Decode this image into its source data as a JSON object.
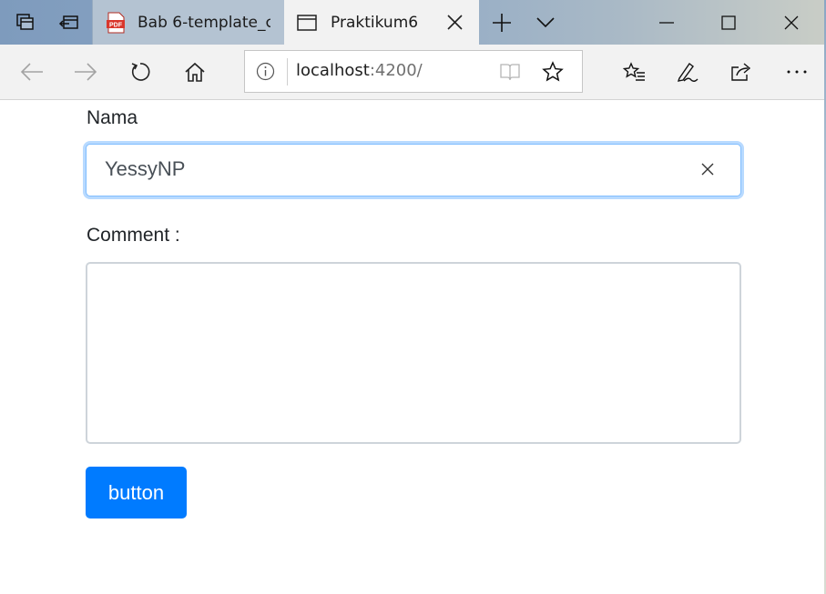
{
  "browser": {
    "tabs": [
      {
        "title": "Bab 6-template_c",
        "icon": "pdf-icon",
        "icon_label": "PDF",
        "active": false
      },
      {
        "title": "Praktikum6",
        "icon": "page-icon",
        "active": true
      }
    ],
    "address": {
      "host": "localhost",
      "rest": ":4200/"
    },
    "colors": {
      "tab_strip": "#8fa9c6",
      "toolbar": "#f2f2f2",
      "pdf_red": "#d9362b"
    }
  },
  "form": {
    "name_label": "Nama",
    "name_value": "YessyNP",
    "comment_label": "Comment :",
    "comment_value": "",
    "button_label": "button",
    "colors": {
      "primary": "#007bff",
      "focus_border": "#80bdff",
      "border": "#ced4da"
    }
  }
}
